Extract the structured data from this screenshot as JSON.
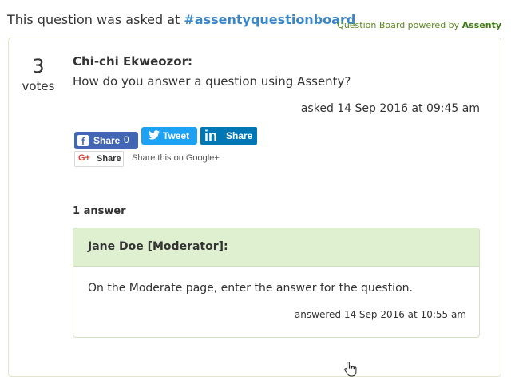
{
  "header": {
    "asked_prefix": "This question was asked at ",
    "hashtag": "#assentyquestionboard",
    "powered_prefix": "Question Board powered by ",
    "powered_brand": "Assenty"
  },
  "question": {
    "votes_count": "3",
    "votes_label": "votes",
    "asker": "Chi-chi Ekweozor:",
    "text": "How do you answer a question using Assenty?",
    "asked_time": "asked 14 Sep 2016 at 09:45 am"
  },
  "share": {
    "facebook_label": "Share",
    "facebook_count": "0",
    "twitter_label": "Tweet",
    "linkedin_label": "Share",
    "linkedin_logo": "in",
    "googleplus_label": "Share",
    "googleplus_logo": "G+",
    "googleplus_text": "Share this on Google+"
  },
  "answers": {
    "heading": "1 answer",
    "items": [
      {
        "author": "Jane Doe [Moderator]:",
        "text": "On the Moderate page, enter the answer for the question.",
        "time": "answered 14 Sep 2016 at 10:55 am"
      }
    ]
  },
  "colors": {
    "hashtag": "#3a87c8",
    "brand_green": "#5b8a1e",
    "answer_header_bg": "#dff0d0",
    "facebook": "#4267b2",
    "twitter": "#1da1f2",
    "linkedin": "#0077b5"
  },
  "icons": [
    "facebook-icon",
    "twitter-bird-icon",
    "linkedin-icon",
    "google-plus-icon",
    "hand-pointer-cursor-icon"
  ]
}
